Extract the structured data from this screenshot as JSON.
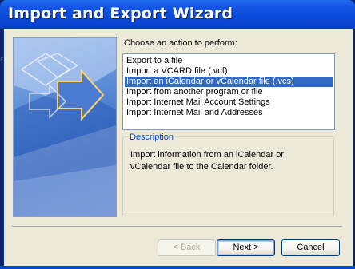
{
  "window": {
    "title": "Import and Export Wizard"
  },
  "prompt": "Choose an action to perform:",
  "actions": {
    "items": [
      "Export to a file",
      "Import a VCARD file (.vcf)",
      "Import an iCalendar or vCalendar file (.vcs)",
      "Import from another program or file",
      "Import Internet Mail Account Settings",
      "Import Internet Mail and Addresses"
    ],
    "selected_index": 2
  },
  "description": {
    "legend": "Description",
    "text": "Import information from an iCalendar or vCalendar file to the Calendar folder."
  },
  "buttons": {
    "back": "< Back",
    "next": "Next >",
    "cancel": "Cancel"
  },
  "colors": {
    "title_bar": "#0a49d8",
    "selection": "#316ac5",
    "legend_text": "#0046d5",
    "dialog_face": "#ece9d8"
  }
}
